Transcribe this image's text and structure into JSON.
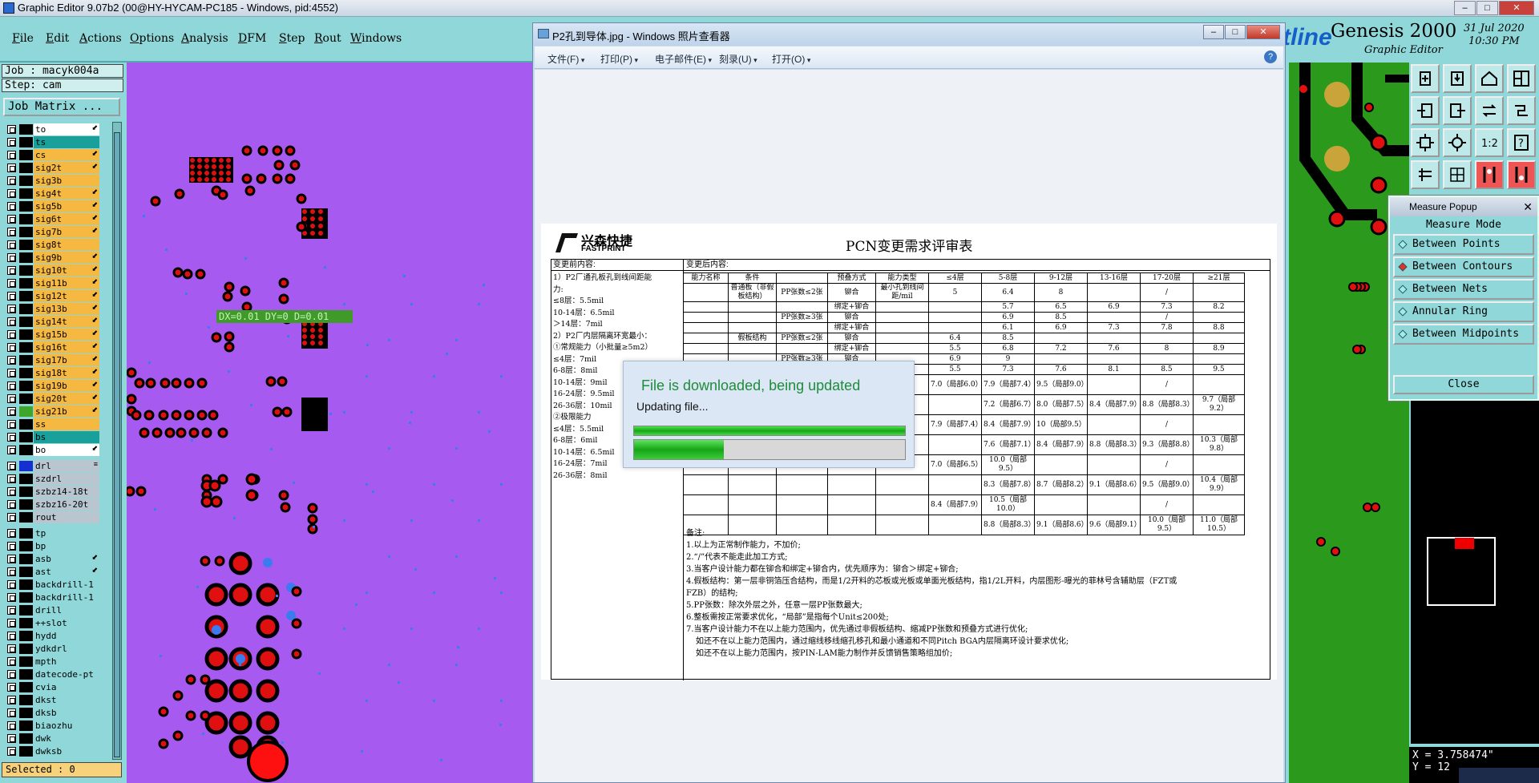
{
  "app": {
    "title": "Graphic Editor 9.07b2 (00@HY-HYCAM-PC185 - Windows, pid:4552)",
    "menu": [
      "File",
      "Edit",
      "Actions",
      "Options",
      "Analysis",
      "DFM",
      "Step",
      "Rout",
      "Windows"
    ],
    "job": "Job : macyk004a",
    "step": "Step: cam",
    "job_matrix": "Job Matrix ...",
    "selected": "Selected : 0",
    "brand": "Genesis 2000",
    "brand_sub": "Graphic Editor",
    "brand_logo": "tline",
    "date": "31 Jul 2020",
    "time": "10:30 PM",
    "measure_readout": "DX=0.01 DY=0 D=0.01"
  },
  "layers": [
    {
      "name": "to",
      "color": "#ffffff",
      "sig": "⬋"
    },
    {
      "name": "ts",
      "color": "#1aa09a",
      "sig": ""
    },
    {
      "name": "cs",
      "color": "#f5b942",
      "sig": "⬋"
    },
    {
      "name": "sig2t",
      "color": "#f5b942",
      "sig": "⬋"
    },
    {
      "name": "sig3b",
      "color": "#f5b942",
      "sig": ""
    },
    {
      "name": "sig4t",
      "color": "#f5b942",
      "sig": "⬋"
    },
    {
      "name": "sig5b",
      "color": "#f5b942",
      "sig": "⬋"
    },
    {
      "name": "sig6t",
      "color": "#f5b942",
      "sig": "⬋"
    },
    {
      "name": "sig7b",
      "color": "#f5b942",
      "sig": "⬋"
    },
    {
      "name": "sig8t",
      "color": "#f5b942",
      "sig": ""
    },
    {
      "name": "sig9b",
      "color": "#f5b942",
      "sig": "⬋"
    },
    {
      "name": "sig10t",
      "color": "#f5b942",
      "sig": "⬋"
    },
    {
      "name": "sig11b",
      "color": "#f5b942",
      "sig": "⬋"
    },
    {
      "name": "sig12t",
      "color": "#f5b942",
      "sig": "⬋"
    },
    {
      "name": "sig13b",
      "color": "#f5b942",
      "sig": "⬋"
    },
    {
      "name": "sig14t",
      "color": "#f5b942",
      "sig": "⬋"
    },
    {
      "name": "sig15b",
      "color": "#f5b942",
      "sig": "⬋"
    },
    {
      "name": "sig16t",
      "color": "#f5b942",
      "sig": "⬋"
    },
    {
      "name": "sig17b",
      "color": "#f5b942",
      "sig": "⬋"
    },
    {
      "name": "sig18t",
      "color": "#f5b942",
      "sig": "⬋"
    },
    {
      "name": "sig19b",
      "color": "#f5b942",
      "sig": "⬋"
    },
    {
      "name": "sig20t",
      "color": "#f5b942",
      "sig": "⬋"
    },
    {
      "name": "sig21b",
      "color": "#f5b942",
      "sig": "⬋"
    },
    {
      "name": "ss",
      "color": "#f5b942",
      "sig": ""
    },
    {
      "name": "bs",
      "color": "#1aa09a",
      "sig": ""
    },
    {
      "name": "bo",
      "color": "#ffffff",
      "sig": "⬋"
    },
    {
      "name": "drl",
      "color": "#b9c6cf",
      "sig": "≡"
    },
    {
      "name": "szdrl",
      "color": "#b9c6cf",
      "sig": ""
    },
    {
      "name": "szbz14-18t",
      "color": "#b9c6cf",
      "sig": ""
    },
    {
      "name": "szbz16-20t",
      "color": "#b9c6cf",
      "sig": ""
    },
    {
      "name": "rout",
      "color": "#b9c6cf",
      "sig": ""
    },
    {
      "name": "tp",
      "color": "#8fd7d8",
      "sig": ""
    },
    {
      "name": "bp",
      "color": "#8fd7d8",
      "sig": ""
    },
    {
      "name": "asb",
      "color": "#8fd7d8",
      "sig": "⬋"
    },
    {
      "name": "ast",
      "color": "#8fd7d8",
      "sig": "⬋"
    },
    {
      "name": "backdrill-1",
      "color": "#8fd7d8",
      "sig": ""
    },
    {
      "name": "backdrill-1",
      "color": "#8fd7d8",
      "sig": ""
    },
    {
      "name": "drill",
      "color": "#8fd7d8",
      "sig": ""
    },
    {
      "name": "++slot",
      "color": "#8fd7d8",
      "sig": ""
    },
    {
      "name": "hydd",
      "color": "#8fd7d8",
      "sig": ""
    },
    {
      "name": "ydkdrl",
      "color": "#8fd7d8",
      "sig": ""
    },
    {
      "name": "mpth",
      "color": "#8fd7d8",
      "sig": ""
    },
    {
      "name": "datecode-pt",
      "color": "#8fd7d8",
      "sig": ""
    },
    {
      "name": "cvia",
      "color": "#8fd7d8",
      "sig": ""
    },
    {
      "name": "dkst",
      "color": "#8fd7d8",
      "sig": ""
    },
    {
      "name": "dksb",
      "color": "#8fd7d8",
      "sig": ""
    },
    {
      "name": "biaozhu",
      "color": "#8fd7d8",
      "sig": ""
    },
    {
      "name": "dwk",
      "color": "#8fd7d8",
      "sig": ""
    },
    {
      "name": "dwksb",
      "color": "#8fd7d8",
      "sig": ""
    }
  ],
  "measure": {
    "title": "Measure Popup",
    "mode_label": "Measure Mode",
    "options": [
      "Between Points",
      "Between Contours",
      "Between Nets",
      "Annular Ring",
      "Between Midpoints"
    ],
    "selected": "Between Contours",
    "close": "Close"
  },
  "coords": {
    "x": "X = 3.758474\"",
    "y": "Y = 12"
  },
  "viewer": {
    "title": "P2孔到导体.jpg - Windows 照片查看器",
    "menu": [
      "文件(F)",
      "打印(P)",
      "电子邮件(E)",
      "刻录(U)",
      "打开(O)"
    ],
    "help": "?"
  },
  "document": {
    "logo_cn": "兴森快捷",
    "logo_en": "FASTPRINT",
    "title": "PCN变更需求评审表",
    "before": "变更前内容:",
    "after": "变更后内容:",
    "left_lines": [
      "1）P2厂通孔板孔到线间距能",
      "力:",
      "≤8层：5.5mil",
      "10-14层：6.5mil",
      "＞14层：7mil",
      "2）P2厂内层隔离环宽最小：",
      "①常规能力（小批量≥5m2）",
      "≤4层：7mil",
      "6-8层：8mil",
      "10-14层：9mil",
      "16-24层：9.5mil",
      "26-36层：10mil",
      "②极限能力",
      "≤4层：5.5mil",
      "6-8层：6mil",
      "10-14层：6.5mil",
      "16-24层：7mil",
      "26-36层：8mil"
    ],
    "table_head": [
      "能力名称",
      "条件",
      "",
      "预叠方式",
      "能力类型",
      "≤4层",
      "5-8层",
      "9-12层",
      "13-16层",
      "17-20层",
      "≥21层"
    ],
    "rows": [
      [
        "",
        "普通板（非假板结构）",
        "PP张数≤2张",
        "铆合",
        "最小孔到线间距/mil",
        "5",
        "6.4",
        "8",
        "",
        "/",
        ""
      ],
      [
        "",
        "",
        "",
        "绑定+铆合",
        "",
        "",
        "5.7",
        "6.5",
        "6.9",
        "7.3",
        "8.2"
      ],
      [
        "",
        "",
        "PP张数≥3张",
        "铆合",
        "",
        "",
        "6.9",
        "8.5",
        "",
        "/",
        ""
      ],
      [
        "",
        "",
        "",
        "绑定+铆合",
        "",
        "",
        "6.1",
        "6.9",
        "7.3",
        "7.8",
        "8.8"
      ],
      [
        "",
        "假板结构",
        "PP张数≤2张",
        "铆合",
        "",
        "6.4",
        "8.5",
        "",
        "",
        "",
        ""
      ],
      [
        "",
        "",
        "",
        "绑定+铆合",
        "",
        "5.5",
        "6.8",
        "7.2",
        "7.6",
        "8",
        "8.9"
      ],
      [
        "",
        "",
        "PP张数≥3张",
        "铆合",
        "",
        "6.9",
        "9",
        "",
        "",
        "",
        ""
      ],
      [
        "",
        "",
        "",
        "绑定+铆合",
        "",
        "5.5",
        "7.3",
        "7.6",
        "8.1",
        "8.5",
        "9.5"
      ]
    ],
    "rows2": [
      [
        "7.9（局部7.4）",
        "9.5（局部9.0）",
        "",
        "/",
        ""
      ],
      [
        "7.2（局部6.7）",
        "8.0（局部7.5）",
        "8.4（局部7.9）",
        "8.8（局部8.3）",
        "9.7（局部9.2）"
      ],
      [
        "8.4（局部7.9）",
        "10（局部9.5）",
        "",
        "/",
        ""
      ],
      [
        "7.6（局部7.1）",
        "8.4（局部7.9）",
        "8.8（局部8.3）",
        "9.3（局部8.8）",
        "10.3（局部9.8）"
      ],
      [
        "10.0（局部9.5）",
        "",
        "",
        "/",
        ""
      ],
      [
        "8.3（局部7.8）",
        "8.7（局部8.2）",
        "9.1（局部8.6）",
        "9.5（局部9.0）",
        "10.4（局部9.9）"
      ],
      [
        "10.5（局部10.0）",
        "",
        "",
        "/",
        ""
      ],
      [
        "8.8（局部8.3）",
        "9.1（局部8.6）",
        "9.6（局部9.1）",
        "10.0（局部9.5）",
        "11.0（局部10.5）"
      ]
    ],
    "col4_2": [
      "7.0（局部6.0）",
      "7.9（局部7.4）",
      "7.0（局部6.5）",
      "8.4（局部7.9）",
      "7.5（局部7.0）"
    ],
    "notes": [
      "备注:",
      "1.以上为正常制作能力，不加价;",
      "2.“/”代表不能走此加工方式;",
      "3.当客户设计能力都在铆合和绑定+铆合内，优先顺序为：铆合＞绑定+铆合;",
      "4.假板结构：第一层非铜箔压合结构，而是1/2开料的芯板或光板或单面光板结构，指1/2L开料，内层图形-曝光的菲林号含辅助层（FZT或",
      "FZB）的结构;",
      "5.PP张数：除次外层之外，任意一层PP张数最大;",
      "6.整板需按正常要求优化，“局部”是指每个Unit≤200处;",
      "7.当客户设计能力不在以上能力范围内，优先通过非假板结构、缩减PP张数和预叠方式进行优化;",
      "如还不在以上能力范围内，通过缩线移线缩孔移孔和最小通道和不同Pitch BGA内层隔离环设计要求优化;",
      "如还不在以上能力范围内，按PIN-LAM能力制作并反馈销售策略组加价;"
    ]
  },
  "download": {
    "heading": "File is downloaded, being updated",
    "sub": "Updating file...",
    "progress1": 1.0,
    "progress2": 0.33
  }
}
